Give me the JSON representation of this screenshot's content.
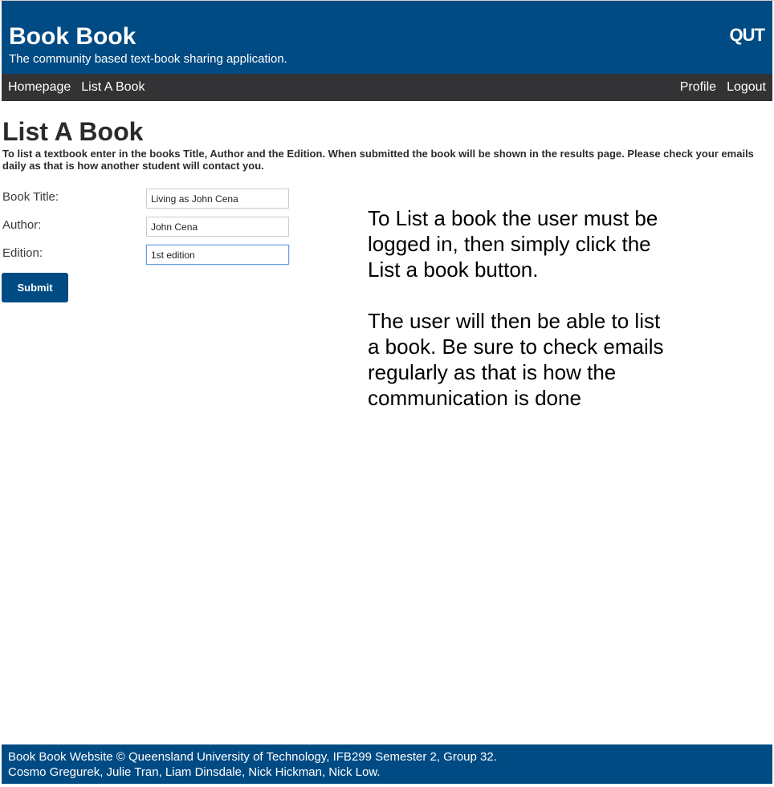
{
  "header": {
    "title": "Book Book",
    "tagline": "The community based text-book sharing application.",
    "logo": "QUT"
  },
  "nav": {
    "left": [
      {
        "label": "Homepage"
      },
      {
        "label": "List A Book"
      }
    ],
    "right": [
      {
        "label": "Profile"
      },
      {
        "label": "Logout"
      }
    ]
  },
  "main": {
    "heading": "List A Book",
    "instructions": "To list a textbook enter in the books Title, Author and the Edition. When submitted the book will be shown in the results page. Please check your emails daily as that is how another student will contact you.",
    "form": {
      "title_label": "Book Title:",
      "title_value": "Living as John Cena",
      "author_label": "Author:",
      "author_value": "John Cena",
      "edition_label": "Edition:",
      "edition_value": "1st edition",
      "submit_label": "Submit"
    },
    "help": {
      "paragraph1": "To List a book the user must be logged in, then simply click the List a book button.",
      "paragraph2": "The user will then be able to list a book. Be sure to check emails regularly as that is how the communication is done"
    }
  },
  "footer": {
    "line1": "Book Book Website © Queensland University of Technology, IFB299 Semester 2, Group 32.",
    "line2": "Cosmo Gregurek, Julie Tran, Liam Dinsdale, Nick Hickman, Nick Low."
  },
  "colors": {
    "brand_blue": "#004b84",
    "nav_dark": "#333336"
  }
}
